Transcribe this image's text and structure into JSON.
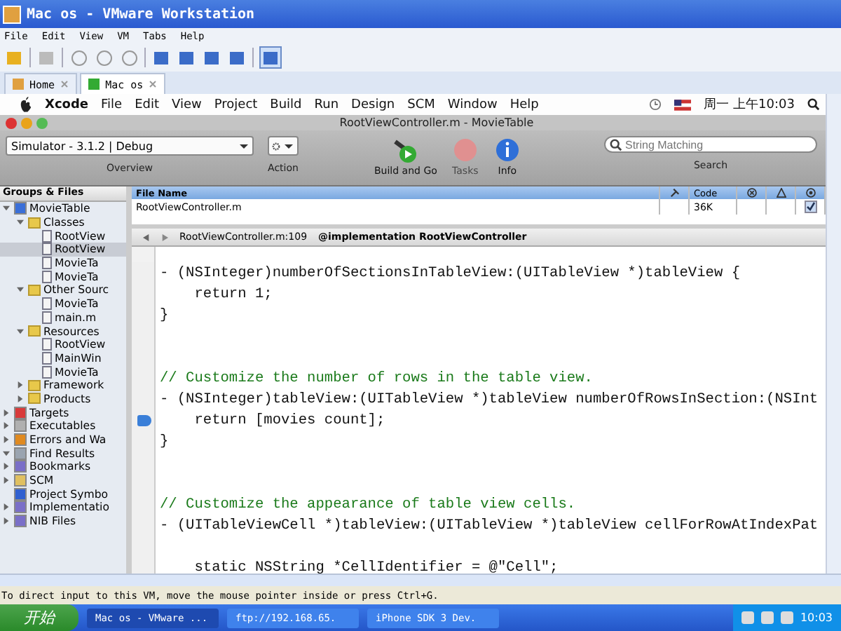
{
  "vm_window": {
    "title": "Mac os - VMware Workstation",
    "menu": [
      "File",
      "Edit",
      "View",
      "VM",
      "Tabs",
      "Help"
    ],
    "tabs": [
      {
        "label": "Home",
        "selected": false
      },
      {
        "label": "Mac os",
        "selected": true
      }
    ]
  },
  "mac_menu_bar": {
    "items": [
      "Xcode",
      "File",
      "Edit",
      "View",
      "Project",
      "Build",
      "Run",
      "Design",
      "SCM",
      "Window",
      "Help"
    ],
    "clock": "周一 上午10:03"
  },
  "xcode": {
    "title": "RootViewController.m - MovieTable",
    "toolbar": {
      "scheme": "Simulator - 3.1.2 | Debug",
      "overview_label": "Overview",
      "action_label": "Action",
      "buttons": [
        {
          "label": "Build and Go",
          "kind": "build",
          "disabled": false
        },
        {
          "label": "Tasks",
          "kind": "tasks",
          "disabled": true
        },
        {
          "label": "Info",
          "kind": "info",
          "disabled": false
        }
      ],
      "search": {
        "placeholder": "String Matching",
        "label": "Search"
      }
    },
    "sidebar": {
      "title": "Groups & Files",
      "items": [
        {
          "label": "MovieTable",
          "kind": "project",
          "expanded": true,
          "selected": false,
          "children": [
            {
              "label": "Classes",
              "kind": "folder",
              "expanded": true,
              "selected": false,
              "children": [
                {
                  "label": "RootView",
                  "kind": "file",
                  "selected": false
                },
                {
                  "label": "RootView",
                  "kind": "file",
                  "selected": true
                },
                {
                  "label": "MovieTa",
                  "kind": "file",
                  "selected": false
                },
                {
                  "label": "MovieTa",
                  "kind": "file",
                  "selected": false
                }
              ]
            },
            {
              "label": "Other Sourc",
              "kind": "folder",
              "expanded": true,
              "selected": false,
              "children": [
                {
                  "label": "MovieTa",
                  "kind": "file",
                  "selected": false
                },
                {
                  "label": "main.m",
                  "kind": "file",
                  "selected": false
                }
              ]
            },
            {
              "label": "Resources",
              "kind": "folder",
              "expanded": true,
              "selected": false,
              "children": [
                {
                  "label": "RootView",
                  "kind": "file",
                  "selected": false
                },
                {
                  "label": "MainWin",
                  "kind": "file",
                  "selected": false
                },
                {
                  "label": "MovieTa",
                  "kind": "file",
                  "selected": false
                }
              ]
            },
            {
              "label": "Framework",
              "kind": "folder",
              "expanded": false,
              "selected": false
            },
            {
              "label": "Products",
              "kind": "folder",
              "expanded": false,
              "selected": false
            }
          ]
        },
        {
          "label": "Targets",
          "kind": "target",
          "expanded": false,
          "selected": false
        },
        {
          "label": "Executables",
          "kind": "executable",
          "expanded": false,
          "selected": false
        },
        {
          "label": "Errors and Wa",
          "kind": "warning",
          "expanded": false,
          "selected": false
        },
        {
          "label": "Find Results",
          "kind": "search",
          "expanded": true,
          "selected": false
        },
        {
          "label": "Bookmarks",
          "kind": "group",
          "expanded": false,
          "selected": false
        },
        {
          "label": "SCM",
          "kind": "scm",
          "expanded": false,
          "selected": false
        },
        {
          "label": "Project Symbo",
          "kind": "symbol",
          "selected": false
        },
        {
          "label": "Implementatio",
          "kind": "group",
          "expanded": false,
          "selected": false
        },
        {
          "label": "NIB Files",
          "kind": "group",
          "expanded": false,
          "selected": false
        }
      ]
    },
    "file_list": {
      "columns": [
        "File Name",
        "Code"
      ],
      "rows": [
        {
          "name": "RootViewController.m",
          "code": "36K",
          "checked": true
        }
      ]
    },
    "navigator": {
      "file": "RootViewController.m:109",
      "symbol": "@implementation RootViewController"
    },
    "code_lines": [
      {
        "text": "- (NSInteger)numberOfSectionsInTableView:(UITableView *)tableView {",
        "kind": "code",
        "breakpoint": false
      },
      {
        "text": "    return 1;",
        "kind": "code",
        "breakpoint": false
      },
      {
        "text": "}",
        "kind": "code",
        "breakpoint": false
      },
      {
        "kind": "blank"
      },
      {
        "kind": "blank"
      },
      {
        "text": "// Customize the number of rows in the table view.",
        "kind": "comment",
        "breakpoint": false
      },
      {
        "text": "- (NSInteger)tableView:(UITableView *)tableView numberOfRowsInSection:(NSInt",
        "kind": "code",
        "breakpoint": false
      },
      {
        "text": "    return [movies count];",
        "kind": "code",
        "breakpoint": true
      },
      {
        "text": "}",
        "kind": "code",
        "breakpoint": false
      },
      {
        "kind": "blank"
      },
      {
        "kind": "blank"
      },
      {
        "text": "// Customize the appearance of table view cells.",
        "kind": "comment",
        "breakpoint": false
      },
      {
        "text": "- (UITableViewCell *)tableView:(UITableView *)tableView cellForRowAtIndexPat",
        "kind": "code",
        "breakpoint": false
      },
      {
        "kind": "blank"
      },
      {
        "text": "    static NSString *CellIdentifier = @\"Cell\";",
        "kind": "code",
        "breakpoint": false
      }
    ]
  },
  "status_bar": {
    "text": "To direct input to this VM, move the mouse pointer inside or press Ctrl+G."
  },
  "taskbar": {
    "start": "开始",
    "tasks": [
      {
        "label": "Mac os - VMware ...",
        "selected": true
      },
      {
        "label": "ftp://192.168.65.",
        "selected": false
      },
      {
        "label": "iPhone SDK 3 Dev.",
        "selected": false
      }
    ],
    "time": "10:03"
  }
}
